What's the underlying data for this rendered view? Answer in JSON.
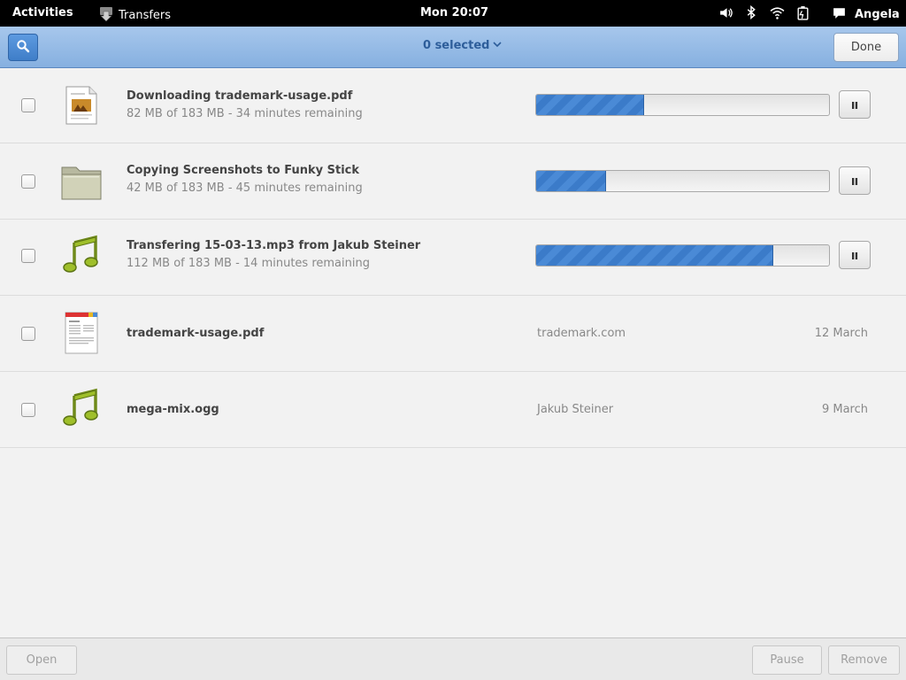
{
  "topbar": {
    "activities": "Activities",
    "app_name": "Transfers",
    "clock": "Mon 20:07",
    "user": "Angela"
  },
  "header": {
    "selection": "0 selected",
    "done_label": "Done"
  },
  "transfers": [
    {
      "title": "Downloading trademark-usage.pdf",
      "subtitle": "82 MB of 183 MB - 34 minutes remaining",
      "progress": 0.37,
      "icon": "document-icon"
    },
    {
      "title": "Copying Screenshots to Funky Stick",
      "subtitle": "42 MB of 183 MB - 45 minutes remaining",
      "progress": 0.24,
      "icon": "folder-icon"
    },
    {
      "title": "Transfering 15-03-13.mp3 from Jakub Steiner",
      "subtitle": "112 MB of 183 MB - 14 minutes remaining",
      "progress": 0.81,
      "icon": "music-note-icon"
    }
  ],
  "completed": [
    {
      "title": "trademark-usage.pdf",
      "source": "trademark.com",
      "date": "12 March",
      "icon": "pdf-icon"
    },
    {
      "title": "mega-mix.ogg",
      "source": "Jakub Steiner",
      "date": "9 March",
      "icon": "music-note-icon"
    }
  ],
  "footer": {
    "open_label": "Open",
    "pause_label": "Pause",
    "remove_label": "Remove"
  },
  "colors": {
    "accent": "#3f7ec8",
    "header_bg": "#a7c7ec",
    "progress_fill": "#4a8ad6"
  }
}
